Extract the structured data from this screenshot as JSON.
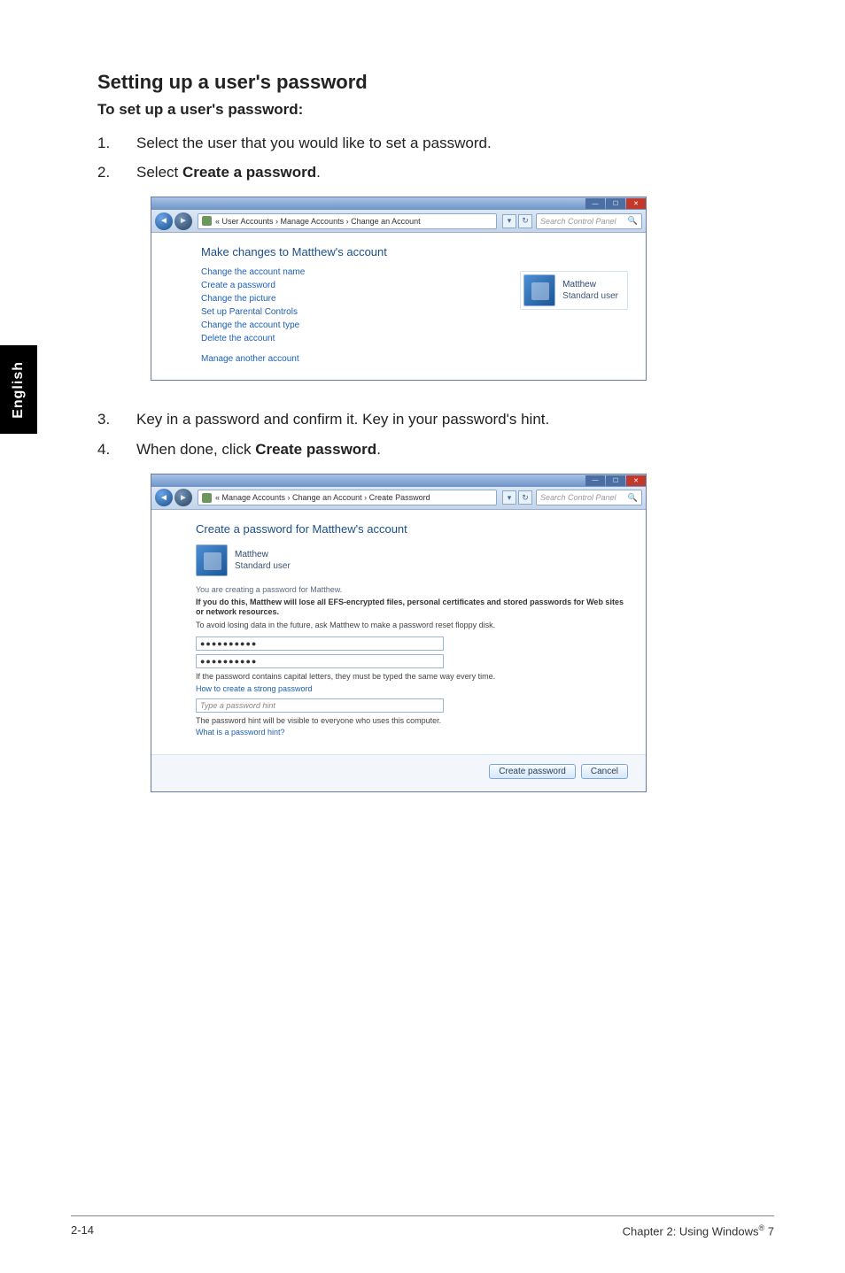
{
  "sideTab": "English",
  "heading": "Setting up a user's password",
  "subheading": "To set up a user's password:",
  "steps1": [
    {
      "num": "1.",
      "text_before": "Select the user that you would like to set a password.",
      "bold": "",
      "text_after": ""
    },
    {
      "num": "2.",
      "text_before": "Select ",
      "bold": "Create a password",
      "text_after": "."
    }
  ],
  "steps2": [
    {
      "num": "3.",
      "text_before": "Key in a password and confirm it. Key in your password's hint.",
      "bold": "",
      "text_after": ""
    },
    {
      "num": "4.",
      "text_before": "When done, click ",
      "bold": "Create password",
      "text_after": "."
    }
  ],
  "shot1": {
    "breadcrumb": "« User Accounts › Manage Accounts › Change an Account",
    "searchPlaceholder": "Search Control Panel",
    "title": "Make changes to Matthew's account",
    "links": [
      "Change the account name",
      "Create a password",
      "Change the picture",
      "Set up Parental Controls",
      "Change the account type",
      "Delete the account"
    ],
    "lastLink": "Manage another account",
    "user": {
      "name": "Matthew",
      "role": "Standard user"
    }
  },
  "shot2": {
    "breadcrumb": "« Manage Accounts › Change an Account › Create Password",
    "searchPlaceholder": "Search Control Panel",
    "title": "Create a password for Matthew's account",
    "user": {
      "name": "Matthew",
      "role": "Standard user"
    },
    "creatingFor": "You are creating a password for Matthew.",
    "warn": "If you do this, Matthew will lose all EFS-encrypted files, personal certificates and stored passwords for Web sites or network resources.",
    "avoid": "To avoid losing data in the future, ask Matthew to make a password reset floppy disk.",
    "pw1": "●●●●●●●●●●",
    "pw2": "●●●●●●●●●●",
    "capNote": "If the password contains capital letters, they must be typed the same way every time.",
    "howLink": "How to create a strong password",
    "hintPlaceholder": "Type a password hint",
    "hintVisible": "The password hint will be visible to everyone who uses this computer.",
    "whatLink": "What is a password hint?",
    "btnCreate": "Create password",
    "btnCancel": "Cancel"
  },
  "footer": {
    "left": "2-14",
    "rightPrefix": "Chapter 2: Using Windows",
    "rightSup": "®",
    "rightSuffix": " 7"
  }
}
